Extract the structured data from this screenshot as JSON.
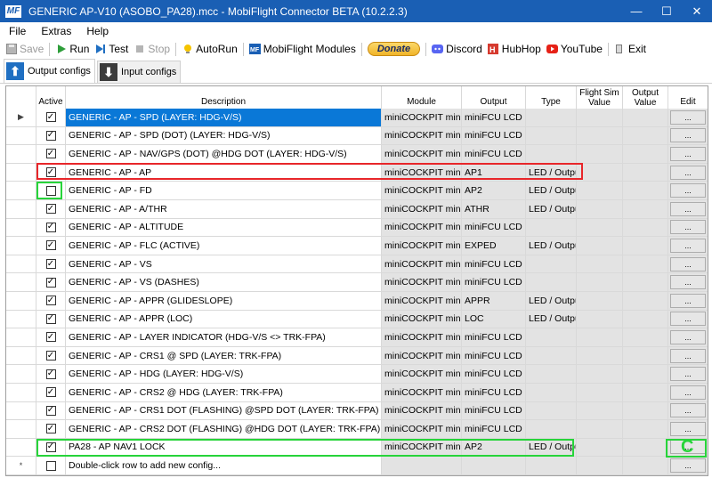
{
  "window": {
    "title": "GENERIC AP-V10 (ASOBO_PA28).mcc - MobiFlight Connector BETA (10.2.2.3)",
    "app_icon_text": "MF",
    "minimize": "—",
    "maximize": "☐",
    "close": "✕"
  },
  "menu": [
    "File",
    "Extras",
    "Help"
  ],
  "toolbar": {
    "save": "Save",
    "run": "Run",
    "test": "Test",
    "stop": "Stop",
    "autorun": "AutoRun",
    "modules": "MobiFlight Modules",
    "donate": "Donate",
    "discord": "Discord",
    "hubhop": "HubHop",
    "youtube": "YouTube",
    "exit": "Exit"
  },
  "tabs": {
    "output": "Output configs",
    "input": "Input configs"
  },
  "columns": {
    "active": "Active",
    "description": "Description",
    "module": "Module",
    "output": "Output",
    "type": "Type",
    "flight_sim_value": "Flight Sim Value",
    "output_value": "Output Value",
    "edit": "Edit"
  },
  "edit_button_label": "...",
  "row_selector_current": "▶",
  "row_selector_new": "*",
  "rows": [
    {
      "active": true,
      "description": "GENERIC - AP - SPD (LAYER: HDG-V/S)",
      "module": "miniCOCKPIT miniFCU",
      "output": "miniFCU LCD",
      "type": ""
    },
    {
      "active": true,
      "description": "GENERIC - AP - SPD (DOT) (LAYER: HDG-V/S)",
      "module": "miniCOCKPIT miniFCU",
      "output": "miniFCU LCD",
      "type": ""
    },
    {
      "active": true,
      "description": "GENERIC - AP - NAV/GPS (DOT) @HDG DOT (LAYER: HDG-V/S)",
      "module": "miniCOCKPIT miniFCU",
      "output": "miniFCU LCD",
      "type": ""
    },
    {
      "active": true,
      "description": "GENERIC - AP - AP",
      "module": "miniCOCKPIT miniFCU",
      "output": "AP1",
      "type": "LED / Output"
    },
    {
      "active": false,
      "description": "GENERIC - AP - FD",
      "module": "miniCOCKPIT miniFCU",
      "output": "AP2",
      "type": "LED / Output"
    },
    {
      "active": true,
      "description": "GENERIC - AP - A/THR",
      "module": "miniCOCKPIT miniFCU",
      "output": "ATHR",
      "type": "LED / Output"
    },
    {
      "active": true,
      "description": "GENERIC - AP - ALTITUDE",
      "module": "miniCOCKPIT miniFCU",
      "output": "miniFCU LCD",
      "type": ""
    },
    {
      "active": true,
      "description": "GENERIC - AP - FLC (ACTIVE)",
      "module": "miniCOCKPIT miniFCU",
      "output": "EXPED",
      "type": "LED / Output"
    },
    {
      "active": true,
      "description": "GENERIC - AP - VS",
      "module": "miniCOCKPIT miniFCU",
      "output": "miniFCU LCD",
      "type": ""
    },
    {
      "active": true,
      "description": "GENERIC - AP - VS (DASHES)",
      "module": "miniCOCKPIT miniFCU",
      "output": "miniFCU LCD",
      "type": ""
    },
    {
      "active": true,
      "description": "GENERIC - AP - APPR (GLIDESLOPE)",
      "module": "miniCOCKPIT miniFCU",
      "output": "APPR",
      "type": "LED / Output"
    },
    {
      "active": true,
      "description": "GENERIC - AP - APPR (LOC)",
      "module": "miniCOCKPIT miniFCU",
      "output": "LOC",
      "type": "LED / Output"
    },
    {
      "active": true,
      "description": "GENERIC - AP - LAYER INDICATOR (HDG-V/S <> TRK-FPA)",
      "module": "miniCOCKPIT miniFCU",
      "output": "miniFCU LCD",
      "type": ""
    },
    {
      "active": true,
      "description": "GENERIC - AP - CRS1 @ SPD (LAYER: TRK-FPA)",
      "module": "miniCOCKPIT miniFCU",
      "output": "miniFCU LCD",
      "type": ""
    },
    {
      "active": true,
      "description": "GENERIC - AP - HDG (LAYER: HDG-V/S)",
      "module": "miniCOCKPIT miniFCU",
      "output": "miniFCU LCD",
      "type": ""
    },
    {
      "active": true,
      "description": "GENERIC - AP - CRS2 @ HDG (LAYER: TRK-FPA)",
      "module": "miniCOCKPIT miniFCU",
      "output": "miniFCU LCD",
      "type": ""
    },
    {
      "active": true,
      "description": "GENERIC - AP - CRS1 DOT (FLASHING) @SPD DOT (LAYER: TRK-FPA)",
      "module": "miniCOCKPIT miniFCU",
      "output": "miniFCU LCD",
      "type": ""
    },
    {
      "active": true,
      "description": "GENERIC - AP - CRS2 DOT (FLASHING) @HDG DOT (LAYER: TRK-FPA)",
      "module": "miniCOCKPIT miniFCU",
      "output": "miniFCU LCD",
      "type": ""
    },
    {
      "active": true,
      "description": "PA28 - AP NAV1 LOCK",
      "module": "miniCOCKPIT miniFCU",
      "output": "AP2",
      "type": "LED / Output"
    }
  ],
  "new_row_text": "Double-click row to add new config...",
  "annotation_letter": "C",
  "colors": {
    "title_bar": "#1a5fb4",
    "selection": "#0a78d7",
    "highlight_red": "#e8262a",
    "highlight_green": "#27d43a"
  }
}
